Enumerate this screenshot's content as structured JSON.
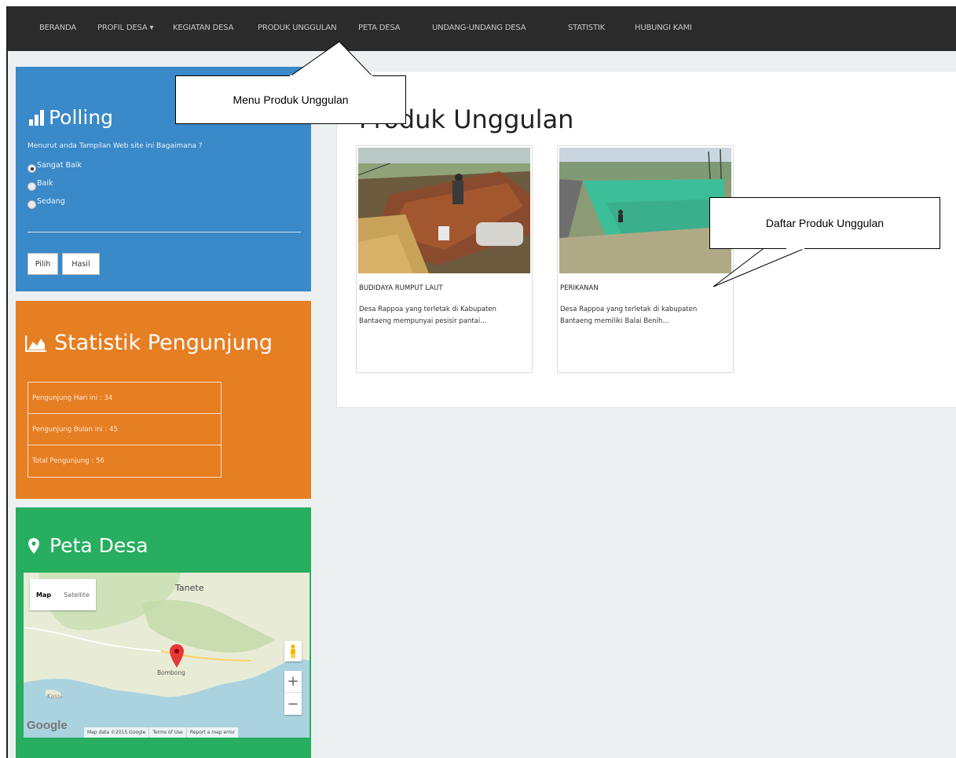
{
  "nav": {
    "items": [
      {
        "label": "BERANDA"
      },
      {
        "label": "PROFIL DESA ▾"
      },
      {
        "label": "KEGIATAN DESA"
      },
      {
        "label": "PRODUK UNGGULAN"
      },
      {
        "label": "PETA DESA"
      },
      {
        "label": "UNDANG-UNDANG DESA"
      },
      {
        "label": "STATISTIK"
      },
      {
        "label": "HUBUNGI KAMI"
      }
    ]
  },
  "polling": {
    "title": "Polling",
    "question": "Menurut anda Tampilan Web site ini Bagaimana ?",
    "options": [
      {
        "label": "Sangat Baik",
        "checked": true
      },
      {
        "label": "Baik",
        "checked": false
      },
      {
        "label": "Sedang",
        "checked": false
      }
    ],
    "pilih_label": "Pilih",
    "hasil_label": "Hasil"
  },
  "statistik": {
    "title": "Statistik Pengunjung",
    "rows": [
      {
        "text": "Pengunjung Hari ini : 34"
      },
      {
        "text": "Pengunjung Bulan ini : 45"
      },
      {
        "text": "Total Pengunjung : 56"
      }
    ]
  },
  "peta": {
    "title": "Peta Desa",
    "map_tab": "Map",
    "satellite_tab": "Satellite",
    "place_tanete": "Tanete",
    "place_bombong": "Bombong",
    "place_kassi": "Kassi",
    "google": "Google",
    "footer": [
      "Map data ©2015 Google",
      "Terms of Use",
      "Report a map error"
    ]
  },
  "main": {
    "title": "Produk Unggulan",
    "products": [
      {
        "name": "BUDIDAYA RUMPUT LAUT",
        "desc": "Desa Rappoa yang terletak di Kabupaten Bantaeng mempunyai pesisir pantai..."
      },
      {
        "name": "PERIKANAN",
        "desc": "Desa Rappoa yang terletak di kabupaten Bantaeng memiliki Balai Benih..."
      }
    ]
  },
  "callouts": {
    "menu": "Menu Produk Unggulan",
    "daftar": "Daftar Produk Unggulan"
  },
  "colors": {
    "navbar": "#2b2b2b",
    "polling_panel": "#3a89c9",
    "statistik_panel": "#e67e22",
    "peta_panel": "#27ae60"
  }
}
